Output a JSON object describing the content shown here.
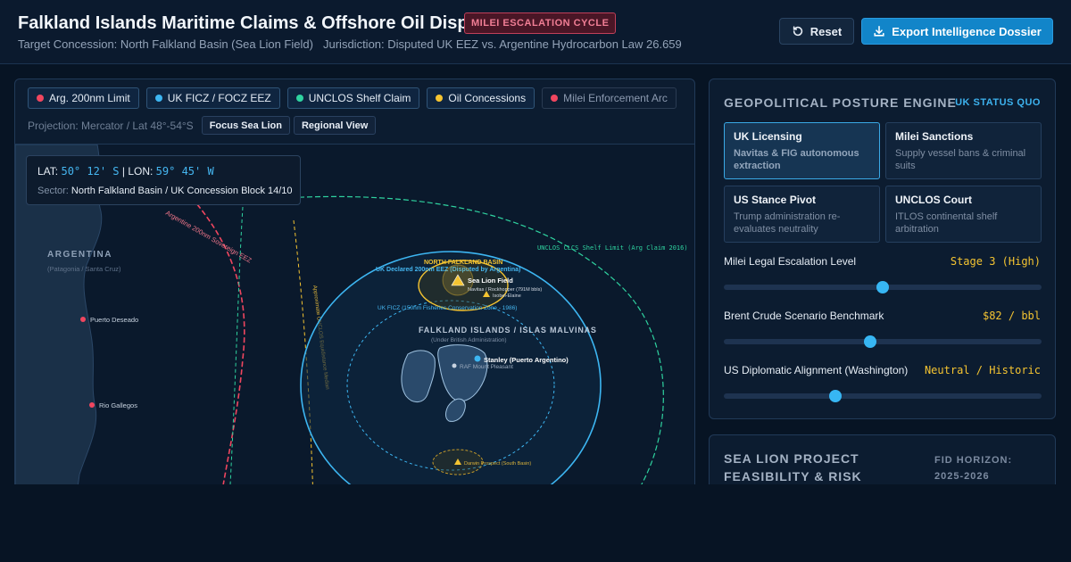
{
  "header": {
    "title": "Falkland Islands Maritime Claims & Offshore Oil Dispute",
    "badge": "MILEI ESCALATION CYCLE",
    "target": "Target Concession: North Falkland Basin (Sea Lion Field)",
    "jurisdiction": "Jurisdiction: Disputed UK EEZ vs. Argentine Hydrocarbon Law 26.659",
    "reset_label": "Reset",
    "export_label": "Export Intelligence Dossier"
  },
  "legend": [
    {
      "label": "Arg. 200nm Limit",
      "color": "#f0465f",
      "active": true
    },
    {
      "label": "UK FICZ / FOCZ EEZ",
      "color": "#3db6f2",
      "active": true
    },
    {
      "label": "UNCLOS Shelf Claim",
      "color": "#2fd3a0",
      "active": true
    },
    {
      "label": "Oil Concessions",
      "color": "#f5c431",
      "active": true
    },
    {
      "label": "Milei Enforcement Arc",
      "color": "#f0465f",
      "active": false
    }
  ],
  "projection": {
    "label": "Projection: Mercator / Lat 48°-54°S",
    "focus_label": "Focus Sea Lion",
    "regional_label": "Regional View"
  },
  "coords": {
    "lat_label": "LAT:",
    "lat": "50° 12' S",
    "lon_label": "LON:",
    "lon": "59° 45' W",
    "sector_label": "Sector:",
    "sector": "North Falkland Basin / UK Concession Block 14/10"
  },
  "map": {
    "argentina": "ARGENTINA",
    "argentina_sub": "(Patagonia / Santa Cruz)",
    "puerto_deseado": "Puerto Deseado",
    "rio_gallegos": "Rio Gallegos",
    "arg_eez": "Argentine 200nm Sovereign EEZ",
    "median_line": "Approximate UNCLOS Equidistance Median",
    "unclos_shelf": "UNCLOS CLCS Shelf Limit (Arg Claim 2016)",
    "nfb": "NORTH FALKLAND BASIN",
    "uk_eez": "UK Declared 200nm EEZ (Disputed by Argentina)",
    "sea_lion": "Sea Lion Field",
    "sea_lion_sub": "Navitas / Rockhopper (791M bbls)",
    "isobel": "Isobel-Elaine",
    "ficz": "UK FICZ (150nm Fisheries Conservation Zone - 1986)",
    "islands": "FALKLAND ISLANDS / ISLAS MALVINAS",
    "islands_sub": "(Under British Administration)",
    "stanley": "Stanley (Puerto Argentino)",
    "raf": "RAF Mount Pleasant",
    "darwin": "Darwin Prospect (South Basin)"
  },
  "posture": {
    "title": "GEOPOLITICAL POSTURE ENGINE",
    "status": "UK STATUS QUO",
    "cards": [
      {
        "title": "UK Licensing",
        "desc": "Navitas & FIG autonomous extraction",
        "active": true
      },
      {
        "title": "Milei Sanctions",
        "desc": "Supply vessel bans & criminal suits",
        "active": false
      },
      {
        "title": "US Stance Pivot",
        "desc": "Trump administration re-evaluates neutrality",
        "active": false
      },
      {
        "title": "UNCLOS Court",
        "desc": "ITLOS continental shelf arbitration",
        "active": false
      }
    ],
    "sliders": [
      {
        "label": "Milei Legal Escalation Level",
        "value": "Stage 3 (High)",
        "fraction": 0.5
      },
      {
        "label": "Brent Crude Scenario Benchmark",
        "value": "$82 / bbl",
        "fraction": 0.46
      },
      {
        "label": "US Diplomatic Alignment (Washington)",
        "value": "Neutral / Historic",
        "fraction": 0.35
      }
    ]
  },
  "risk": {
    "title_line1": "SEA LION PROJECT",
    "title_line2": "FEASIBILITY & RISK",
    "horizon_line1": "FID HORIZON:",
    "horizon_line2": "2025-2026"
  }
}
